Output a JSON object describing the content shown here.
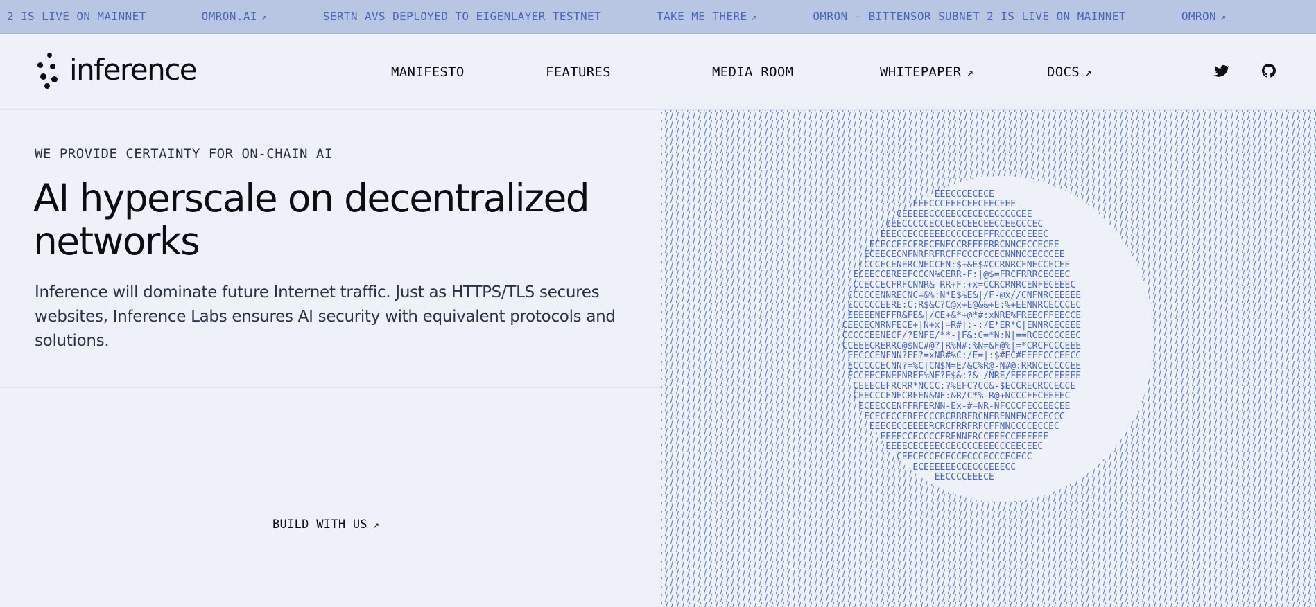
{
  "ticker": {
    "items": [
      {
        "text": "2 IS LIVE ON MAINNET",
        "link": false
      },
      {
        "text": "OMRON.AI",
        "link": true,
        "arrow": "↗"
      },
      {
        "text": "SERTN AVS DEPLOYED TO EIGENLAYER TESTNET",
        "link": false
      },
      {
        "text": "TAKE ME THERE",
        "link": true,
        "arrow": "↗"
      },
      {
        "text": "OMRON - BITTENSOR SUBNET 2 IS LIVE ON MAINNET",
        "link": false
      },
      {
        "text": "OMRON",
        "link": true,
        "arrow": "↗"
      }
    ]
  },
  "header": {
    "brand": "inference",
    "nav": [
      {
        "label": "MANIFESTO",
        "arrow": ""
      },
      {
        "label": "FEATURES",
        "arrow": ""
      },
      {
        "label": "MEDIA ROOM",
        "arrow": ""
      },
      {
        "label": "WHITEPAPER",
        "arrow": "↗"
      },
      {
        "label": "DOCS",
        "arrow": "↗"
      }
    ],
    "social": [
      "twitter-icon",
      "github-icon"
    ]
  },
  "hero": {
    "eyebrow": "WE PROVIDE CERTAINTY FOR ON-CHAIN AI",
    "headline": "AI hyperscale on decentralized networks",
    "description": "Inference will dominate future Internet traffic. Just as HTTPS/TLS secures websites, Inference Labs ensures AI security with equivalent protocols and solutions.",
    "cta": "BUILD WITH US",
    "cta_arrow": "↗"
  },
  "colors": {
    "ticker_bg": "#b9c6e3",
    "accent": "#4a66b7",
    "page_bg": "#eef1f8",
    "text": "#0b0d12"
  }
}
